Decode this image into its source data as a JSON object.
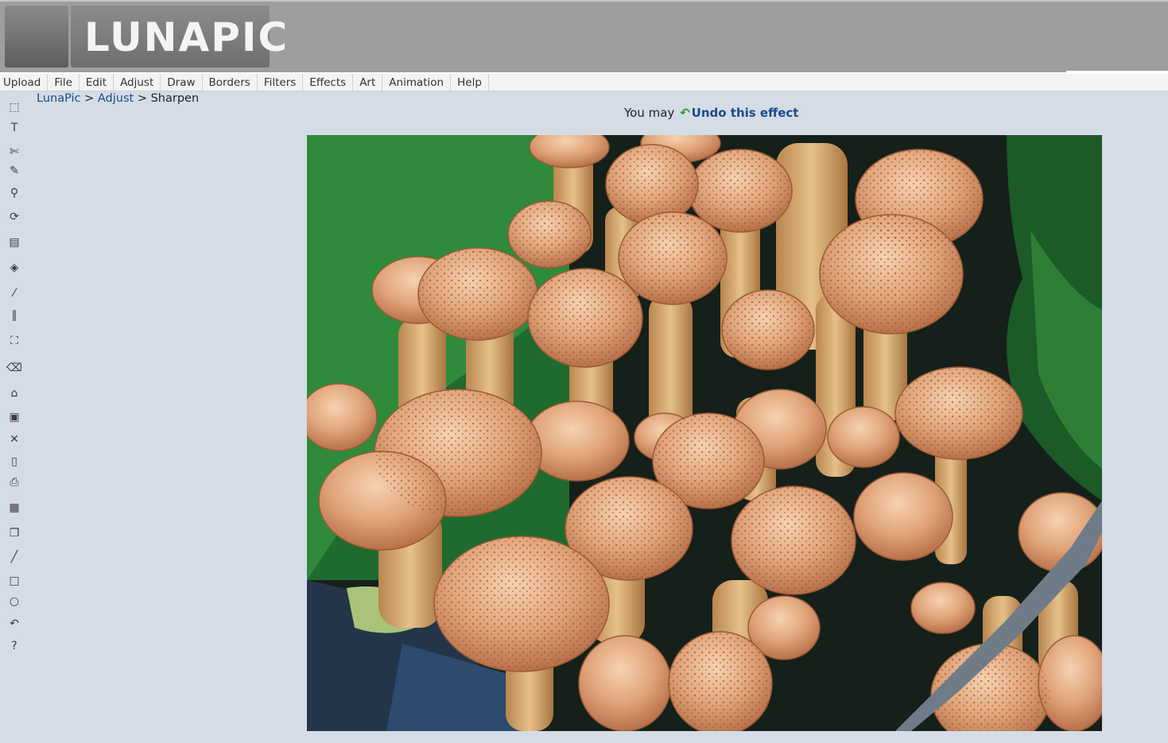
{
  "header": {
    "logo_text": "LUNAPIC"
  },
  "menu": {
    "items": [
      "Upload",
      "File",
      "Edit",
      "Adjust",
      "Draw",
      "Borders",
      "Filters",
      "Effects",
      "Art",
      "Animation",
      "Help"
    ]
  },
  "breadcrumb": {
    "home": "LunaPic",
    "sep1": " > ",
    "section": "Adjust",
    "sep2": " > ",
    "current": "Sharpen"
  },
  "undo": {
    "prefix": "You may ",
    "link": "Undo this effect"
  },
  "toolbar": {
    "tools": [
      {
        "name": "select-icon",
        "glyph": "⬚"
      },
      {
        "name": "text-icon",
        "glyph": "T"
      },
      {
        "name": "scissors-icon",
        "glyph": "✄"
      },
      {
        "name": "pencil-icon",
        "glyph": "✎"
      },
      {
        "name": "zoom-icon",
        "glyph": "⚲"
      },
      {
        "name": "rotate-icon",
        "glyph": "⟳"
      },
      {
        "name": "gradient-icon",
        "glyph": "▤"
      },
      {
        "name": "paint-bucket-icon",
        "glyph": "◈"
      },
      {
        "name": "eyedropper-icon",
        "glyph": "⁄"
      },
      {
        "name": "brush-icon",
        "glyph": "∥"
      },
      {
        "name": "crop-icon",
        "glyph": "⛶"
      },
      {
        "name": "eraser-icon",
        "glyph": "⌫"
      },
      {
        "name": "open-folder-icon",
        "glyph": "⌂"
      },
      {
        "name": "save-icon",
        "glyph": "▣"
      },
      {
        "name": "close-icon",
        "glyph": "✕"
      },
      {
        "name": "new-document-icon",
        "glyph": "▯"
      },
      {
        "name": "print-icon",
        "glyph": "⎙"
      },
      {
        "name": "layers-icon",
        "glyph": "▦"
      },
      {
        "name": "copy-icon",
        "glyph": "❐"
      },
      {
        "name": "line-icon",
        "glyph": "╱"
      },
      {
        "name": "rectangle-icon",
        "glyph": "□"
      },
      {
        "name": "circle-icon",
        "glyph": "○"
      },
      {
        "name": "undo-icon",
        "glyph": "↶"
      },
      {
        "name": "help-icon",
        "glyph": "?"
      }
    ]
  },
  "image": {
    "description_icon": "mushrooms-photo"
  }
}
